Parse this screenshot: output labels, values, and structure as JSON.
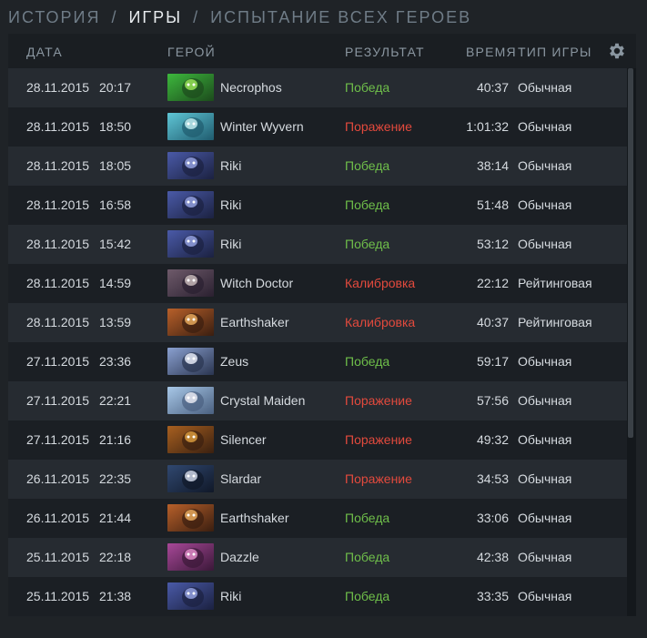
{
  "breadcrumb": {
    "items": [
      {
        "label": "ИСТОРИЯ",
        "current": false
      },
      {
        "label": "ИГРЫ",
        "current": true
      },
      {
        "label": "ИСПЫТАНИЕ ВСЕХ ГЕРОЕВ",
        "current": false
      }
    ],
    "separator": "/"
  },
  "table": {
    "columns": {
      "date": "ДАТА",
      "hero": "ГЕРОЙ",
      "result": "РЕЗУЛЬТАТ",
      "duration": "ВРЕМЯ",
      "game_type": "ТИП ИГРЫ"
    },
    "rows": [
      {
        "date": "28.11.2015",
        "time": "20:17",
        "hero": "Necrophos",
        "hero_icon": "necrophos-portrait",
        "result": "Победа",
        "result_kind": "win",
        "duration": "40:37",
        "game_type": "Обычная"
      },
      {
        "date": "28.11.2015",
        "time": "18:50",
        "hero": "Winter Wyvern",
        "hero_icon": "winter-wyvern-portrait",
        "result": "Поражение",
        "result_kind": "loss",
        "duration": "1:01:32",
        "game_type": "Обычная"
      },
      {
        "date": "28.11.2015",
        "time": "18:05",
        "hero": "Riki",
        "hero_icon": "riki-portrait",
        "result": "Победа",
        "result_kind": "win",
        "duration": "38:14",
        "game_type": "Обычная"
      },
      {
        "date": "28.11.2015",
        "time": "16:58",
        "hero": "Riki",
        "hero_icon": "riki-portrait",
        "result": "Победа",
        "result_kind": "win",
        "duration": "51:48",
        "game_type": "Обычная"
      },
      {
        "date": "28.11.2015",
        "time": "15:42",
        "hero": "Riki",
        "hero_icon": "riki-portrait",
        "result": "Победа",
        "result_kind": "win",
        "duration": "53:12",
        "game_type": "Обычная"
      },
      {
        "date": "28.11.2015",
        "time": "14:59",
        "hero": "Witch Doctor",
        "hero_icon": "witch-doctor-portrait",
        "result": "Калибровка",
        "result_kind": "calibration",
        "duration": "22:12",
        "game_type": "Рейтинговая"
      },
      {
        "date": "28.11.2015",
        "time": "13:59",
        "hero": "Earthshaker",
        "hero_icon": "earthshaker-portrait",
        "result": "Калибровка",
        "result_kind": "calibration",
        "duration": "40:37",
        "game_type": "Рейтинговая"
      },
      {
        "date": "27.11.2015",
        "time": "23:36",
        "hero": "Zeus",
        "hero_icon": "zeus-portrait",
        "result": "Победа",
        "result_kind": "win",
        "duration": "59:17",
        "game_type": "Обычная"
      },
      {
        "date": "27.11.2015",
        "time": "22:21",
        "hero": "Crystal Maiden",
        "hero_icon": "crystal-maiden-portrait",
        "result": "Поражение",
        "result_kind": "loss",
        "duration": "57:56",
        "game_type": "Обычная"
      },
      {
        "date": "27.11.2015",
        "time": "21:16",
        "hero": "Silencer",
        "hero_icon": "silencer-portrait",
        "result": "Поражение",
        "result_kind": "loss",
        "duration": "49:32",
        "game_type": "Обычная"
      },
      {
        "date": "26.11.2015",
        "time": "22:35",
        "hero": "Slardar",
        "hero_icon": "slardar-portrait",
        "result": "Поражение",
        "result_kind": "loss",
        "duration": "34:53",
        "game_type": "Обычная"
      },
      {
        "date": "26.11.2015",
        "time": "21:44",
        "hero": "Earthshaker",
        "hero_icon": "earthshaker-portrait",
        "result": "Победа",
        "result_kind": "win",
        "duration": "33:06",
        "game_type": "Обычная"
      },
      {
        "date": "25.11.2015",
        "time": "22:18",
        "hero": "Dazzle",
        "hero_icon": "dazzle-portrait",
        "result": "Победа",
        "result_kind": "win",
        "duration": "42:38",
        "game_type": "Обычная"
      },
      {
        "date": "25.11.2015",
        "time": "21:38",
        "hero": "Riki",
        "hero_icon": "riki-portrait",
        "result": "Победа",
        "result_kind": "win",
        "duration": "33:35",
        "game_type": "Обычная"
      }
    ]
  },
  "settings_icon": "gear-icon",
  "colors": {
    "win": "#6fbf4a",
    "loss": "#e34a3d",
    "background": "#1f2327",
    "panel": "#14181c"
  }
}
